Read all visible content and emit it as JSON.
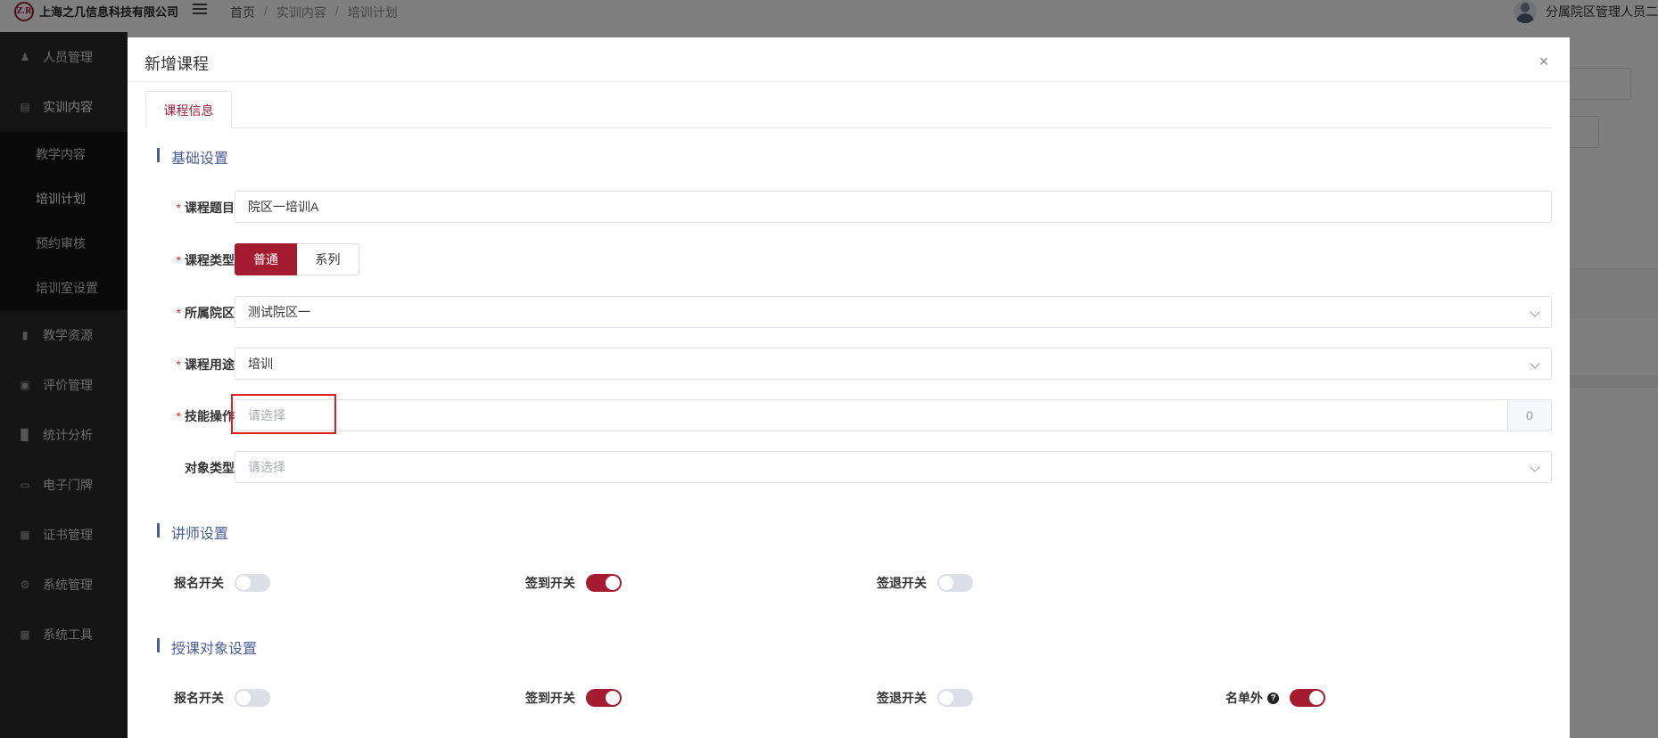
{
  "header": {
    "logo_mark": "Z.R",
    "company": "上海之几信息科技有限公司",
    "breadcrumb": [
      "首页",
      "实训内容",
      "培训计划"
    ],
    "breadcrumb_sep": "/",
    "user_name": "分属院区管理人员二"
  },
  "sidebar": {
    "items": [
      {
        "label": "人员管理",
        "icon": "person-icon"
      },
      {
        "label": "实训内容",
        "icon": "content-icon"
      },
      {
        "label": "教学资源",
        "icon": "resource-icon"
      },
      {
        "label": "评价管理",
        "icon": "evaluation-icon"
      },
      {
        "label": "统计分析",
        "icon": "bar-chart-icon"
      },
      {
        "label": "电子门牌",
        "icon": "monitor-icon"
      },
      {
        "label": "证书管理",
        "icon": "certificate-icon"
      },
      {
        "label": "系统管理",
        "icon": "gear-icon"
      },
      {
        "label": "系统工具",
        "icon": "toolbox-icon"
      }
    ],
    "submenu": [
      {
        "label": "教学内容"
      },
      {
        "label": "培训计划"
      },
      {
        "label": "预约审核"
      },
      {
        "label": "培训室设置"
      }
    ],
    "active_sub": "培训计划"
  },
  "modal": {
    "title": "新增课程",
    "close": "×",
    "tab": "课程信息",
    "sections": {
      "basic": "基础设置",
      "lecturer": "讲师设置",
      "audience": "授课对象设置"
    },
    "form": {
      "required_mark": "*",
      "course_title_label": "课程题目",
      "course_title_value": "院区一培训A",
      "course_type_label": "课程类型",
      "course_type_options": [
        "普通",
        "系列"
      ],
      "course_type_selected": "普通",
      "campus_label": "所属院区",
      "campus_value": "测试院区一",
      "usage_label": "课程用途",
      "usage_value": "培训",
      "skill_label": "技能操作",
      "skill_placeholder": "请选择",
      "skill_count": "0",
      "object_type_label": "对象类型",
      "object_type_placeholder": "请选择"
    },
    "lecturer_switches": [
      {
        "label": "报名开关",
        "on": false
      },
      {
        "label": "签到开关",
        "on": true
      },
      {
        "label": "签退开关",
        "on": false
      }
    ],
    "audience_switches": [
      {
        "label": "报名开关",
        "on": false
      },
      {
        "label": "签到开关",
        "on": true
      },
      {
        "label": "签退开关",
        "on": false
      },
      {
        "label": "名单外",
        "on": true,
        "help": "?"
      }
    ]
  },
  "colors": {
    "accent": "#a51c30",
    "section": "#4a5c9b",
    "sidebar_bg": "#2b2b2b",
    "highlight": "#e02020"
  }
}
